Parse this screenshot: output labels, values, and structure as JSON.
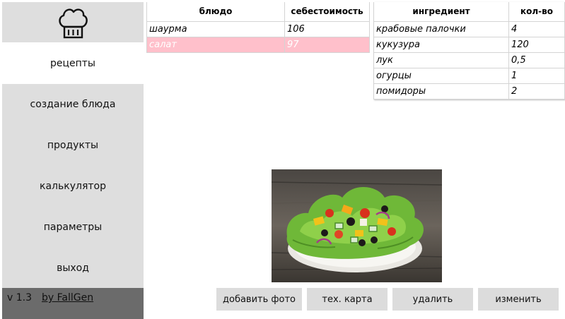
{
  "sidebar": {
    "logo_icon": "chef-hat-icon",
    "items": [
      {
        "label": "рецепты",
        "active": true
      },
      {
        "label": "создание блюда",
        "active": false
      },
      {
        "label": "продукты",
        "active": false
      },
      {
        "label": "калькулятор",
        "active": false
      },
      {
        "label": "параметры",
        "active": false
      },
      {
        "label": "выход",
        "active": false
      }
    ],
    "version": "v 1.3",
    "author": "by FallGen"
  },
  "dishes_table": {
    "columns": [
      "блюдо",
      "себестоимость"
    ],
    "rows": [
      {
        "name": "шаурма",
        "cost": "106",
        "selected": false
      },
      {
        "name": "салат",
        "cost": "97",
        "selected": true
      }
    ]
  },
  "ingredients_table": {
    "columns": [
      "ингредиент",
      "кол-во"
    ],
    "rows": [
      {
        "name": "крабовые палочки",
        "qty": "4"
      },
      {
        "name": "кукузура",
        "qty": "120"
      },
      {
        "name": "лук",
        "qty": "0,5"
      },
      {
        "name": "огурцы",
        "qty": "1"
      },
      {
        "name": "помидоры",
        "qty": "2"
      }
    ]
  },
  "photo": {
    "icon": "salad-photo"
  },
  "actions": {
    "add_photo": "добавить фото",
    "tech_card": "тех. карта",
    "delete": "удалить",
    "edit": "изменить"
  },
  "colors": {
    "sidebar_bg": "#dedede",
    "footer_bg": "#6b6b6b",
    "selected_row": "#ffc0cb",
    "button_bg": "#dcdcdc"
  }
}
